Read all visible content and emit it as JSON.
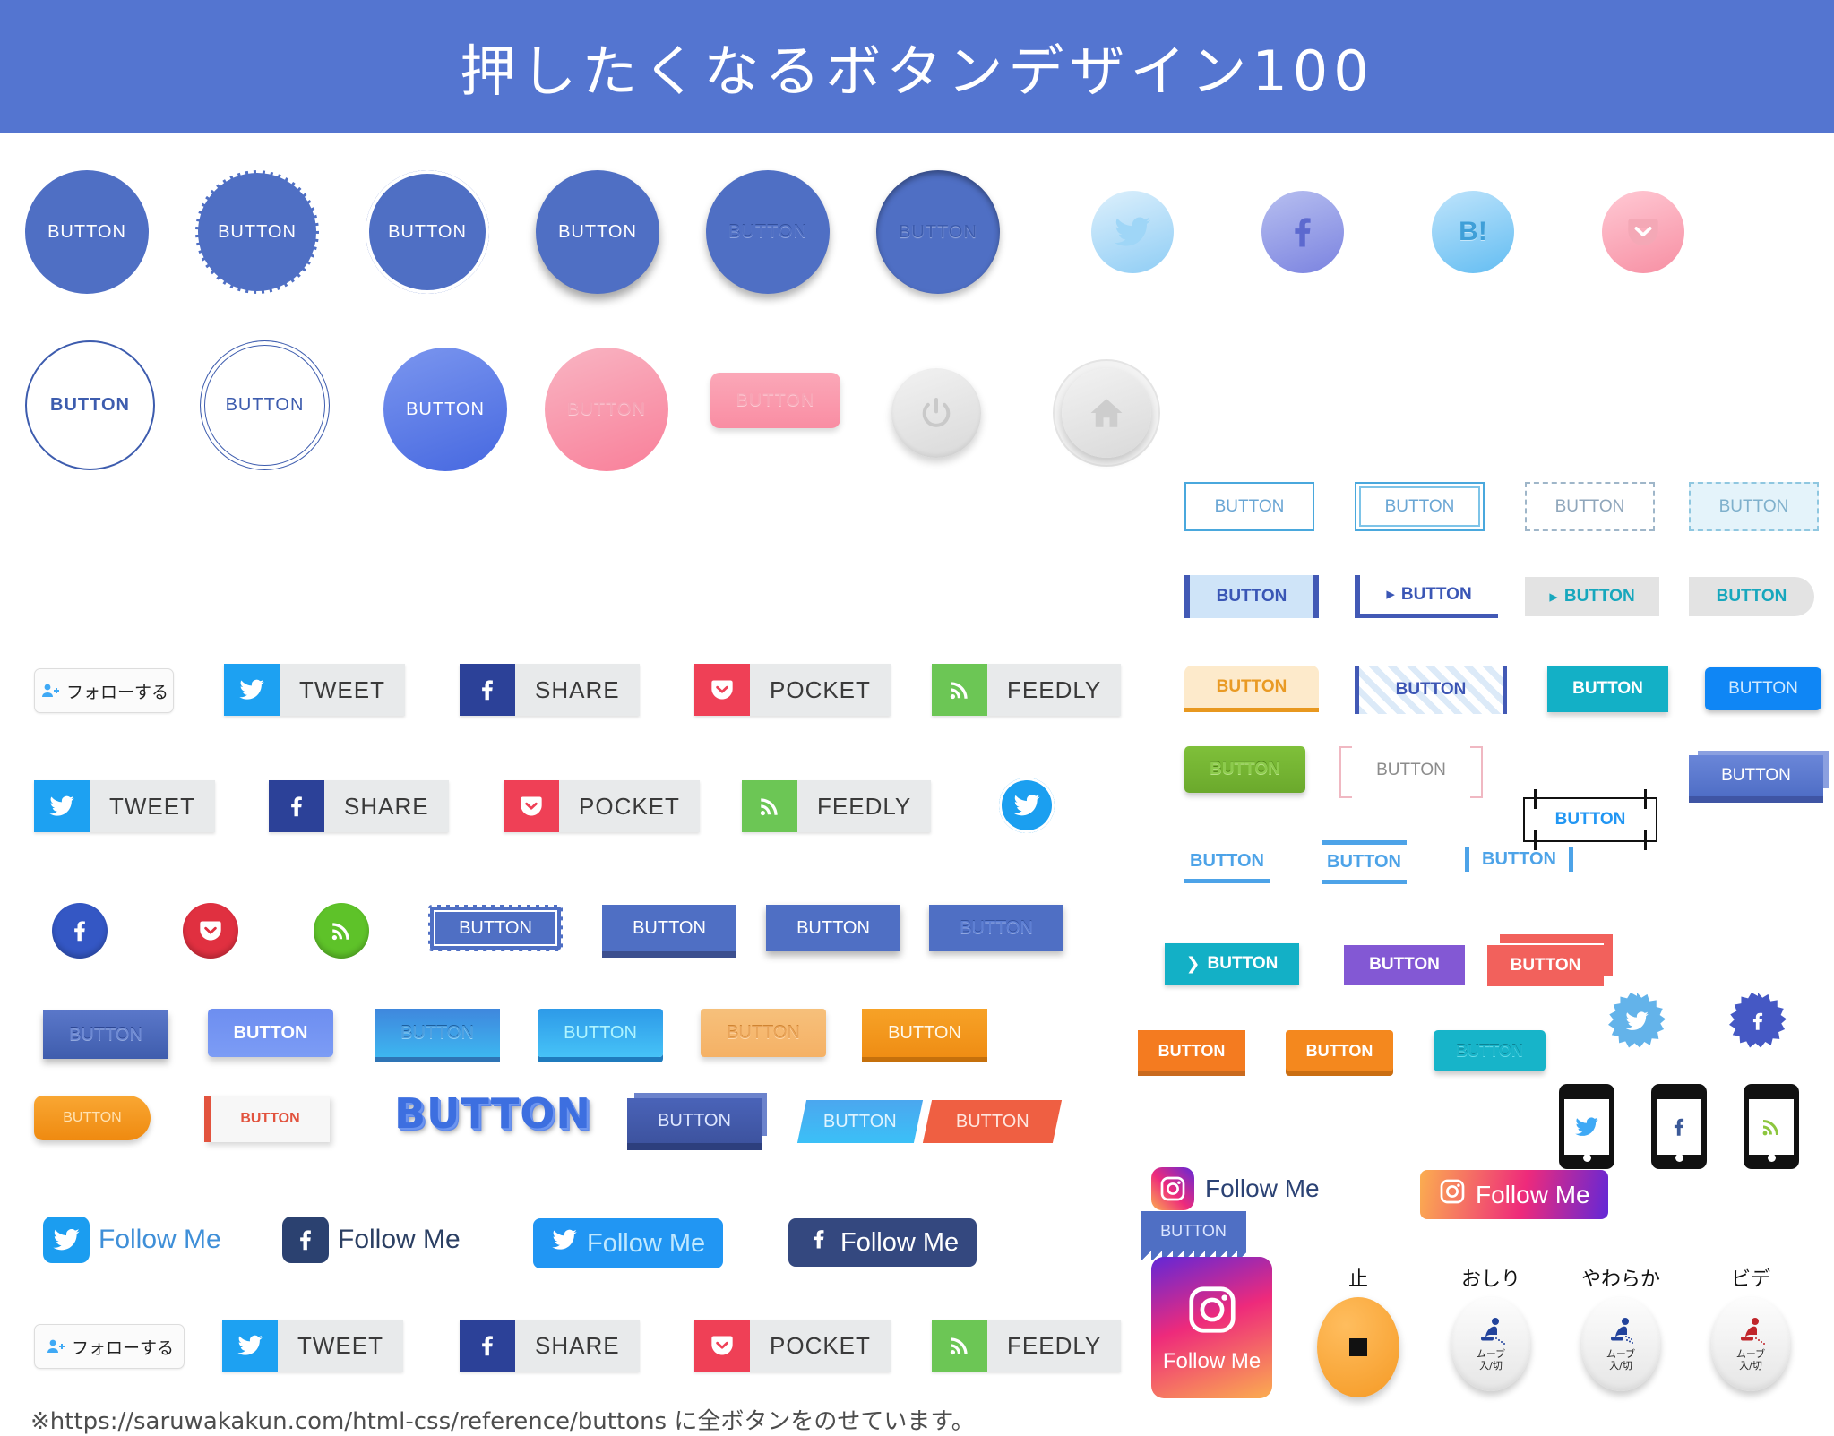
{
  "header": {
    "title": "押したくなるボタンデザイン100",
    "bg": "#5475d0"
  },
  "labels": {
    "button": "BUTTON",
    "follow_jp": "フォローする",
    "tweet": "TWEET",
    "share": "SHARE",
    "pocket": "POCKET",
    "feedly": "FEEDLY",
    "follow_me": "Follow Me",
    "hatena": "B!"
  },
  "circles_row1": [
    {
      "label": "BUTTON",
      "style": "flat"
    },
    {
      "label": "BUTTON",
      "style": "dashed-border"
    },
    {
      "label": "BUTTON",
      "style": "inner-ring"
    },
    {
      "label": "BUTTON",
      "style": "drop-shadow"
    },
    {
      "label": "BUTTON",
      "style": "embossed"
    },
    {
      "label": "BUTTON",
      "style": "inset"
    }
  ],
  "social_circles_row1": [
    {
      "icon": "twitter-icon",
      "color": "#8fcdf5"
    },
    {
      "icon": "facebook-icon",
      "color": "#7b83e0"
    },
    {
      "icon": "hatena-icon",
      "label": "B!",
      "color": "#63bdf2"
    },
    {
      "icon": "pocket-icon",
      "color": "#f78fa3"
    }
  ],
  "circles_row2": [
    {
      "label": "BUTTON",
      "style": "outline"
    },
    {
      "label": "BUTTON",
      "style": "double-outline"
    },
    {
      "label": "BUTTON",
      "style": "gradient-blue"
    },
    {
      "label": "BUTTON",
      "style": "gradient-pink"
    },
    {
      "label": "BUTTON",
      "style": "pink-rounded-rect"
    }
  ],
  "gray_buttons": [
    {
      "icon": "power-icon"
    },
    {
      "icon": "home-icon"
    }
  ],
  "outline_buttons": [
    {
      "label": "BUTTON",
      "style": "solid-outline"
    },
    {
      "label": "BUTTON",
      "style": "double-outline"
    },
    {
      "label": "BUTTON",
      "style": "dashed-gray"
    },
    {
      "label": "BUTTON",
      "style": "dashed-filled"
    }
  ],
  "bar_buttons": [
    {
      "label": "BUTTON",
      "style": "side-bars-filled"
    },
    {
      "label": "BUTTON",
      "style": "corner-bars",
      "arrow": "▸"
    },
    {
      "label": "BUTTON",
      "style": "gray-arrow",
      "arrow": "▸"
    },
    {
      "label": "BUTTON",
      "style": "gray-round-right"
    }
  ],
  "share_bars_gray": [
    {
      "label": "フォローする",
      "icon": "follow-icon",
      "style": "outline-card"
    },
    {
      "label": "TWEET",
      "icon": "twitter-icon",
      "color": "#1da1f2"
    },
    {
      "label": "SHARE",
      "icon": "facebook-icon",
      "color": "#2c4198"
    },
    {
      "label": "POCKET",
      "icon": "pocket-icon",
      "color": "#ef4056"
    },
    {
      "label": "FEEDLY",
      "icon": "rss-icon",
      "color": "#6cc655"
    }
  ],
  "share_bars_row2": [
    {
      "label": "TWEET",
      "icon": "twitter-icon",
      "color": "#1da1f2"
    },
    {
      "label": "SHARE",
      "icon": "facebook-icon",
      "color": "#2c4198"
    },
    {
      "label": "POCKET",
      "icon": "pocket-icon",
      "color": "#ef4056"
    },
    {
      "label": "FEEDLY",
      "icon": "rss-icon",
      "color": "#6cc655"
    }
  ],
  "colored_right_row1": [
    {
      "label": "BUTTON",
      "style": "yellow-underline",
      "color": "#e99a24"
    },
    {
      "label": "BUTTON",
      "style": "diagonal-stripes",
      "color": "#3c55b4"
    },
    {
      "label": "BUTTON",
      "style": "teal-solid",
      "color": "#13b0c6"
    },
    {
      "label": "BUTTON",
      "style": "blue-rounded",
      "color": "#0f86f5"
    }
  ],
  "colored_right_row2": [
    {
      "label": "BUTTON",
      "style": "green-emboss",
      "color": "#6ba92c"
    },
    {
      "label": "BUTTON",
      "style": "bracket",
      "color": "#8c8c8c"
    },
    {
      "label": "BUTTON",
      "style": "corner-marks",
      "color": "#2196f3"
    },
    {
      "label": "BUTTON",
      "style": "blue-3d-box",
      "color": "#4f6ec6"
    }
  ],
  "underline_buttons": [
    {
      "label": "BUTTON",
      "style": "bottom-line"
    },
    {
      "label": "BUTTON",
      "style": "top-bottom-line"
    },
    {
      "label": "BUTTON",
      "style": "side-lines"
    }
  ],
  "solid_small_row": [
    {
      "label": "BUTTON",
      "style": "teal-arrow",
      "arrow": "❯",
      "color": "#13b0c6"
    },
    {
      "label": "BUTTON",
      "style": "purple-lines",
      "color": "#8358d4"
    },
    {
      "label": "BUTTON",
      "style": "red-offset-shadow",
      "color": "#f2615c"
    }
  ],
  "orange_row": [
    {
      "label": "BUTTON",
      "style": "orange-3d",
      "color": "#f47b20"
    },
    {
      "label": "BUTTON",
      "style": "orange-rounded-3d",
      "color": "#f4881e"
    },
    {
      "label": "BUTTON",
      "style": "teal-emboss",
      "color": "#17b4c9"
    }
  ],
  "zigzag_button": {
    "label": "BUTTON",
    "color": "#4f6fc4"
  },
  "star_badges": [
    {
      "icon": "twitter-icon",
      "color": "#63b3ea"
    },
    {
      "icon": "facebook-icon",
      "color": "#4558c4"
    }
  ],
  "phone_icons": [
    {
      "icon": "twitter-icon",
      "color": "#3fa9f5"
    },
    {
      "icon": "facebook-icon",
      "color": "#3b5998"
    },
    {
      "icon": "rss-icon",
      "color": "#8dc63f"
    }
  ],
  "social_round_icons": [
    {
      "icon": "facebook-icon",
      "color": "#3457c4"
    },
    {
      "icon": "pocket-icon",
      "color": "#e03040"
    },
    {
      "icon": "rss-icon",
      "color": "#5ec229"
    },
    {
      "icon": "twitter-icon",
      "color": "#1b9ff0"
    }
  ],
  "blue_box_buttons": [
    {
      "label": "BUTTON",
      "style": "dashed-inner"
    },
    {
      "label": "BUTTON",
      "style": "hard-shadow"
    },
    {
      "label": "BUTTON",
      "style": "soft-shadow"
    },
    {
      "label": "BUTTON",
      "style": "embossed"
    }
  ],
  "gradient_row": [
    {
      "label": "BUTTON",
      "style": "navy-emboss"
    },
    {
      "label": "BUTTON",
      "style": "periwinkle-bold"
    },
    {
      "label": "BUTTON",
      "style": "blue-emboss-3d"
    },
    {
      "label": "BUTTON",
      "style": "cyan-3d"
    },
    {
      "label": "BUTTON",
      "style": "peach-emboss"
    },
    {
      "label": "BUTTON",
      "style": "orange-3d"
    }
  ],
  "special_row": [
    {
      "label": "BUTTON",
      "style": "orange-pill"
    },
    {
      "label": "BUTTON",
      "style": "white-red-bar"
    },
    {
      "label": "BUTTON",
      "style": "text-3d"
    },
    {
      "label": "BUTTON",
      "style": "blue-3d-block"
    },
    {
      "label": "BUTTON",
      "style": "skew-blue"
    },
    {
      "label": "BUTTON",
      "style": "skew-red"
    }
  ],
  "follow_me_buttons": [
    {
      "label": "Follow Me",
      "icon": "twitter-icon",
      "style": "icon-square-blue"
    },
    {
      "label": "Follow Me",
      "icon": "facebook-icon",
      "style": "icon-square-navy"
    },
    {
      "label": "Follow Me",
      "icon": "twitter-icon",
      "style": "pill-blue"
    },
    {
      "label": "Follow Me",
      "icon": "facebook-icon",
      "style": "pill-navy"
    }
  ],
  "instagram_buttons": [
    {
      "label": "Follow Me",
      "style": "icon-left-text-dark"
    },
    {
      "label": "Follow Me",
      "style": "gradient-pill"
    },
    {
      "label": "Follow Me",
      "style": "gradient-card"
    }
  ],
  "toilet_panel": [
    {
      "title": "止",
      "style": "stop",
      "sub": ""
    },
    {
      "title": "おしり",
      "style": "spray-blue",
      "sub": "ムーブ\n入/切"
    },
    {
      "title": "やわらか",
      "style": "spray-soft",
      "sub": "ムーブ\n入/切"
    },
    {
      "title": "ビデ",
      "style": "bidet-red",
      "sub": "ムーブ\n入/切"
    }
  ],
  "toilet_sub_label": "ムーブ 入/切",
  "footer": {
    "note": "※https://saruwakakun.com/html-css/reference/buttons に全ボタンをのせています。"
  }
}
